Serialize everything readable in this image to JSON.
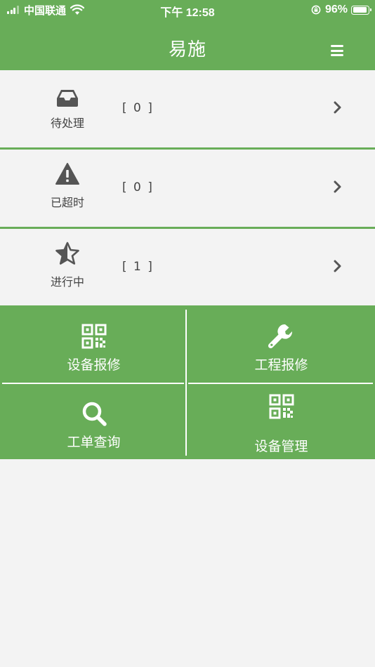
{
  "status_bar": {
    "carrier": "中国联通",
    "time": "下午 12:58",
    "battery": "96%",
    "battery_level": 0.96
  },
  "header": {
    "title": "易施",
    "menu_icon": "hamburger-menu-icon"
  },
  "status_items": [
    {
      "label": "待处理",
      "count": "[ 0 ]",
      "icon": "inbox-tray-icon"
    },
    {
      "label": "已超时",
      "count": "[ 0 ]",
      "icon": "warning-triangle-icon"
    },
    {
      "label": "进行中",
      "count": "[ 1 ]",
      "icon": "half-star-icon"
    }
  ],
  "functions": [
    {
      "label": "设备报修",
      "icon": "qr-code-icon"
    },
    {
      "label": "工程报修",
      "icon": "wrench-icon"
    },
    {
      "label": "工单查询",
      "icon": "search-icon"
    },
    {
      "label": "设备管理",
      "icon": "qr-code-icon"
    }
  ],
  "colors": {
    "primary": "#68ad58",
    "background": "#f3f3f3",
    "text": "#444444",
    "icon": "#555555"
  }
}
